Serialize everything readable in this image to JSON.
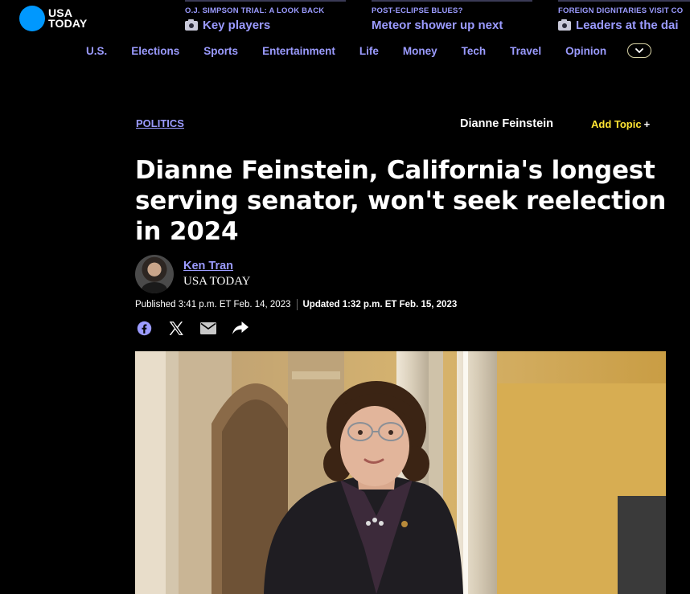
{
  "header": {
    "logo": {
      "line1": "USA",
      "line2": "TODAY",
      "brand_color": "#0098fe"
    },
    "promos": [
      {
        "kicker": "O.J. SIMPSON TRIAL: A LOOK BACK",
        "title": "Key players",
        "icon": "camera-icon"
      },
      {
        "kicker": "POST-ECLIPSE BLUES?",
        "title": "Meteor shower up next"
      },
      {
        "kicker": "FOREIGN DIGNITARIES VISIT CO",
        "title": "Leaders at the dai",
        "icon": "camera-icon"
      }
    ],
    "nav": [
      "U.S.",
      "Elections",
      "Sports",
      "Entertainment",
      "Life",
      "Money",
      "Tech",
      "Travel",
      "Opinion"
    ],
    "nav_more_icon": "chevron-down-icon"
  },
  "article": {
    "section": "POLITICS",
    "topic": "Dianne Feinstein",
    "add_topic": "Add Topic",
    "add_topic_plus": "+",
    "headline": "Dianne Feinstein, California's longest serving senator, won't seek reelection in 2024",
    "author": {
      "name": "Ken Tran",
      "org": "USA TODAY"
    },
    "published": "Published 3:41 p.m. ET Feb. 14, 2023",
    "updated": "Updated 1:32 p.m. ET Feb. 15, 2023",
    "share_icons": [
      "facebook-icon",
      "x-icon",
      "email-icon",
      "share-icon"
    ]
  },
  "colors": {
    "link": "#9b9bff",
    "add_topic": "#ffe433",
    "background": "#000000"
  }
}
